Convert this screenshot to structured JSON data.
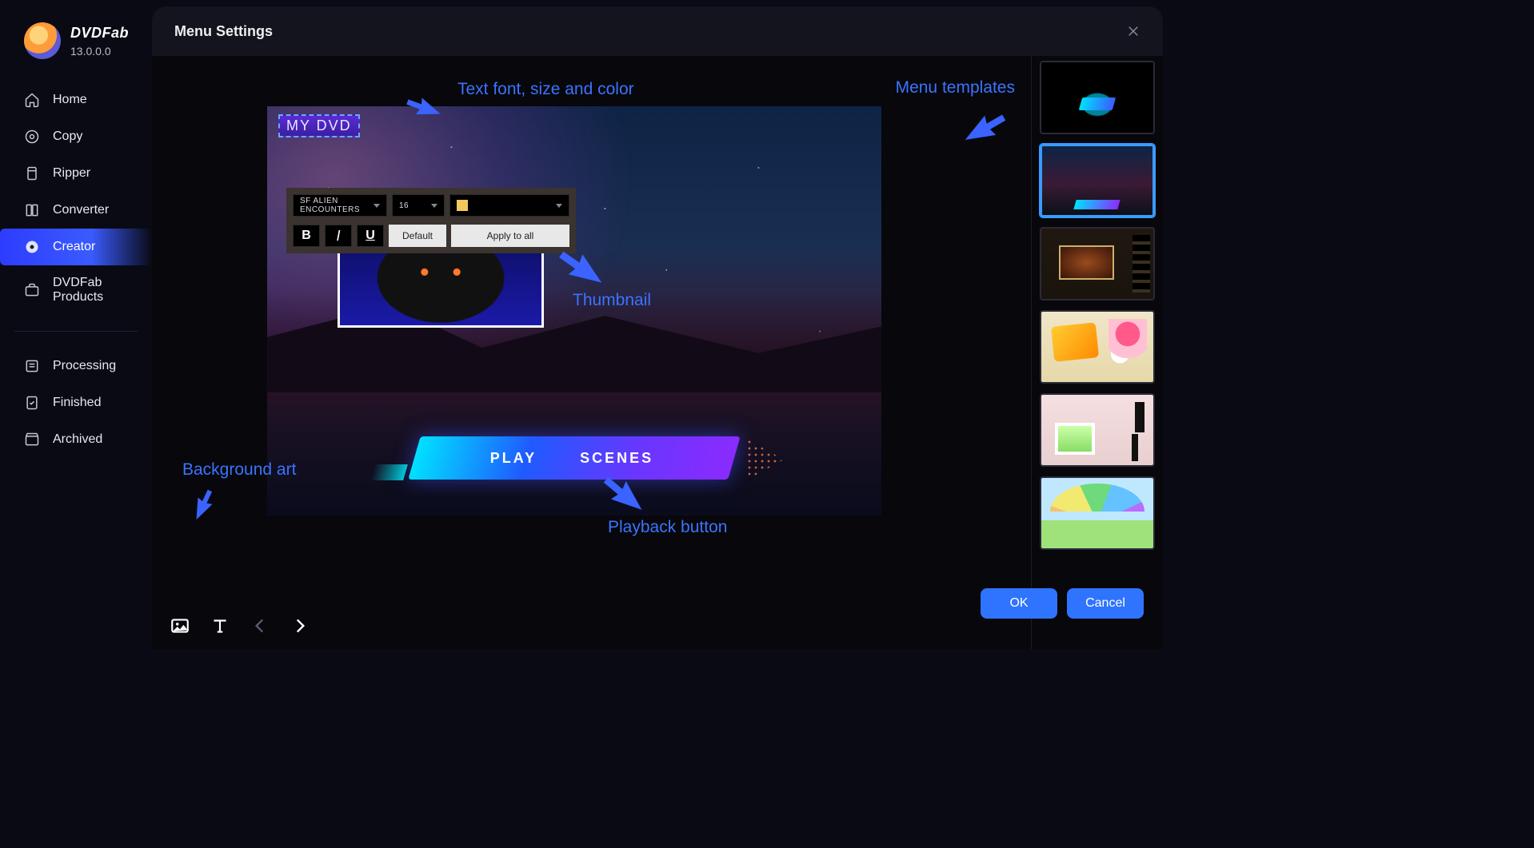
{
  "app": {
    "name": "DVDFab",
    "version": "13.0.0.0"
  },
  "sidebar": {
    "items": [
      {
        "label": "Home",
        "icon": "home-icon"
      },
      {
        "label": "Copy",
        "icon": "copy-icon"
      },
      {
        "label": "Ripper",
        "icon": "ripper-icon"
      },
      {
        "label": "Converter",
        "icon": "converter-icon"
      },
      {
        "label": "Creator",
        "icon": "creator-icon",
        "active": true
      },
      {
        "label": "DVDFab Products",
        "icon": "products-icon"
      }
    ],
    "secondary": [
      {
        "label": "Processing",
        "icon": "processing-icon"
      },
      {
        "label": "Finished",
        "icon": "finished-icon"
      },
      {
        "label": "Archived",
        "icon": "archived-icon"
      }
    ]
  },
  "dialog": {
    "title": "Menu Settings",
    "preview": {
      "dvd_title": "MY DVD",
      "play_label": "PLAY",
      "scenes_label": "SCENES"
    },
    "text_toolbar": {
      "font_family": "SF ALIEN ENCOUNTERS",
      "font_size": "16",
      "color_hex": "#f5c85f",
      "bold_label": "B",
      "italic_label": "I",
      "underline_label": "U",
      "default_label": "Default",
      "apply_all_label": "Apply to all"
    },
    "annotations": {
      "text_controls": "Text font, size and color",
      "menu_templates": "Menu templates",
      "thumbnail": "Thumbnail",
      "background_art": "Background art",
      "playback_button": "Playback button"
    },
    "bottom_tools": {
      "image": "image-tool",
      "text": "text-tool",
      "prev": "prev-page",
      "next": "next-page"
    },
    "templates": [
      {
        "id": "neon-dark",
        "selected": false
      },
      {
        "id": "nebula-landscape",
        "selected": true
      },
      {
        "id": "film-reel",
        "selected": false
      },
      {
        "id": "birthday-party",
        "selected": false
      },
      {
        "id": "wedding-pink",
        "selected": false
      },
      {
        "id": "kids-rainbow",
        "selected": false
      }
    ],
    "footer": {
      "ok": "OK",
      "cancel": "Cancel"
    }
  }
}
